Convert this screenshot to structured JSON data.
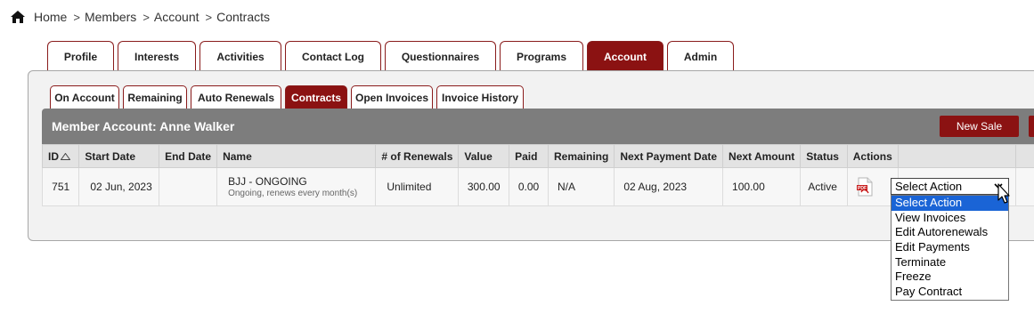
{
  "breadcrumb": {
    "items": [
      "Home",
      "Members",
      "Account",
      "Contracts"
    ],
    "separator": ">"
  },
  "main_tabs": [
    {
      "label": "Profile",
      "active": false
    },
    {
      "label": "Interests",
      "active": false
    },
    {
      "label": "Activities",
      "active": false
    },
    {
      "label": "Contact Log",
      "active": false
    },
    {
      "label": "Questionnaires",
      "active": false
    },
    {
      "label": "Programs",
      "active": false
    },
    {
      "label": "Account",
      "active": true
    },
    {
      "label": "Admin",
      "active": false
    }
  ],
  "sub_tabs": [
    {
      "label": "On Account",
      "active": false
    },
    {
      "label": "Remaining",
      "active": false
    },
    {
      "label": "Auto Renewals",
      "active": false
    },
    {
      "label": "Contracts",
      "active": true
    },
    {
      "label": "Open Invoices",
      "active": false
    },
    {
      "label": "Invoice History",
      "active": false
    }
  ],
  "header": {
    "title": "Member Account: Anne Walker",
    "new_sale_label": "New Sale"
  },
  "table": {
    "columns": [
      "ID",
      "Start Date",
      "End Date",
      "Name",
      "# of Renewals",
      "Value",
      "Paid",
      "Remaining",
      "Next Payment Date",
      "Next Amount",
      "Status",
      "Actions"
    ],
    "rows": [
      {
        "id": "751",
        "start_date": "02 Jun, 2023",
        "end_date": "",
        "name": "BJJ - ONGOING",
        "name_sub": "Ongoing, renews every month(s)",
        "renewals": "Unlimited",
        "value": "300.00",
        "paid": "0.00",
        "remaining": "N/A",
        "next_payment_date": "02 Aug, 2023",
        "next_amount": "100.00",
        "status": "Active"
      }
    ]
  },
  "action_select": {
    "value": "Select Action",
    "options": [
      "Select Action",
      "View Invoices",
      "Edit Autorenewals",
      "Edit Payments",
      "Terminate",
      "Freeze",
      "Pay Contract"
    ],
    "highlighted_index": 0
  },
  "colors": {
    "accent": "#8b1212",
    "header_bar": "#7d7d7d",
    "highlight": "#1a64d6"
  },
  "icons": {
    "home": "home-icon",
    "sort": "sort-asc-icon",
    "pdf": "pdf-icon",
    "chevron": "chevron-down-icon",
    "cursor": "mouse-cursor-icon"
  }
}
